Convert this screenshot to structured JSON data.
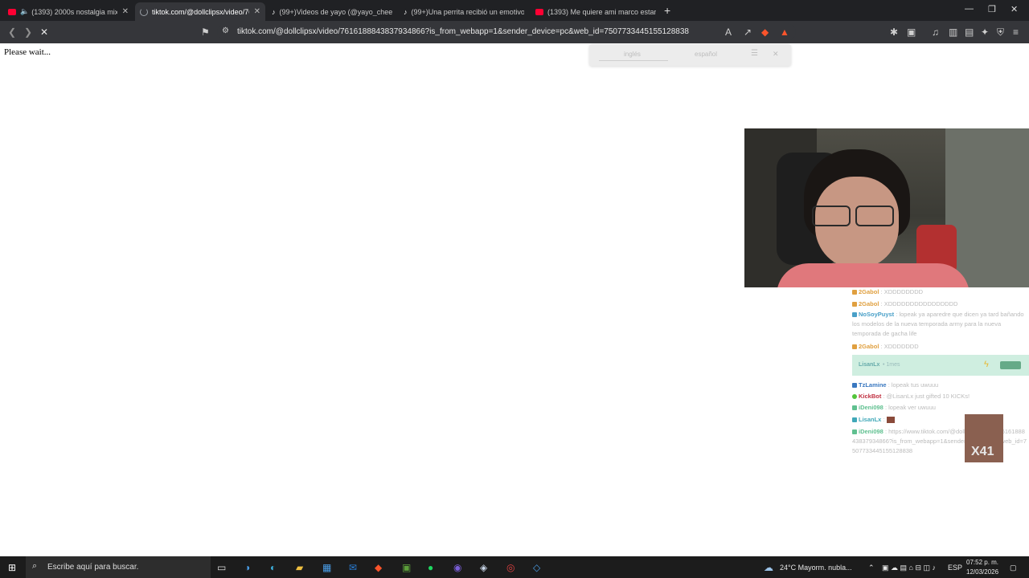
{
  "browser": {
    "tabs": [
      {
        "title": "(1393) 2000s nostalgia mix -",
        "icon": "youtube-icon",
        "active": false
      },
      {
        "title": "tiktok.com/@dollclipsx/video/76",
        "icon": "loading-icon",
        "active": true
      },
      {
        "title": "(99+)Videos de yayo (@yayo_cheese",
        "icon": "tiktok-icon",
        "active": false
      },
      {
        "title": "(99+)Una perrita recibió un emotivo",
        "icon": "tiktok-icon",
        "active": false
      },
      {
        "title": "(1393) Me quiere ami marco estar vs",
        "icon": "youtube-icon",
        "active": false
      }
    ],
    "new_tab": "+",
    "url": "tiktok.com/@dollclipsx/video/7616188843837934866?is_from_webapp=1&sender_device=pc&web_id=7507733445155128838",
    "colors": {
      "tab_bg": "#202124",
      "active_tab": "#35363a",
      "accent": "#fb542b"
    }
  },
  "page": {
    "status_text": "Please wait...",
    "translate_popup": {
      "source": "inglés",
      "target": "español"
    }
  },
  "chat": {
    "messages": [
      {
        "user": "2Gabol",
        "text": ": XDDDDDDDD",
        "color": "#e0a040"
      },
      {
        "user": "2Gabol",
        "text": ": XDDDDDDDDDDDDDDDD",
        "color": "#e0a040"
      },
      {
        "user": "NoSoyPuyst",
        "text": ": lopeak ya aparedre que dicen ya tard bañando los modelos de la nueva temporada army para la nueva temporada de gacha life",
        "color": "#4aa0c8"
      },
      {
        "user": "2Gabol",
        "text": ": XDDDDDDD",
        "color": "#e0a040"
      },
      {
        "user": "TzLamine",
        "text": ": lopeak tus uwuuu",
        "color": "#3a78c0"
      },
      {
        "user": "KickBot",
        "text": ": @LisanLx just gifted 10 KICKs!",
        "color": "#c03040"
      },
      {
        "user": "iDeni098",
        "text": ": lopeak ver uwuuu",
        "color": "#60c090"
      },
      {
        "user": "LisanLx",
        "text": ":",
        "color": "#40a8b8"
      },
      {
        "user": "iDeni098",
        "text": ": https://www.tiktok.com/@dollclipsx/video/7616188843837934866?is_from_webapp=1&sender_device=pc&web_id=7507733445155128838",
        "color": "#60c090"
      }
    ],
    "sub_banner": {
      "user": "LisanLx",
      "text": "• 1mes"
    },
    "emote_count": "X41"
  },
  "taskbar": {
    "search_placeholder": "Escribe aquí para buscar.",
    "weather": "24°C  Mayorm. nubla...",
    "language": "ESP",
    "time": "07:52 p. m.",
    "date": "12/03/2026"
  }
}
